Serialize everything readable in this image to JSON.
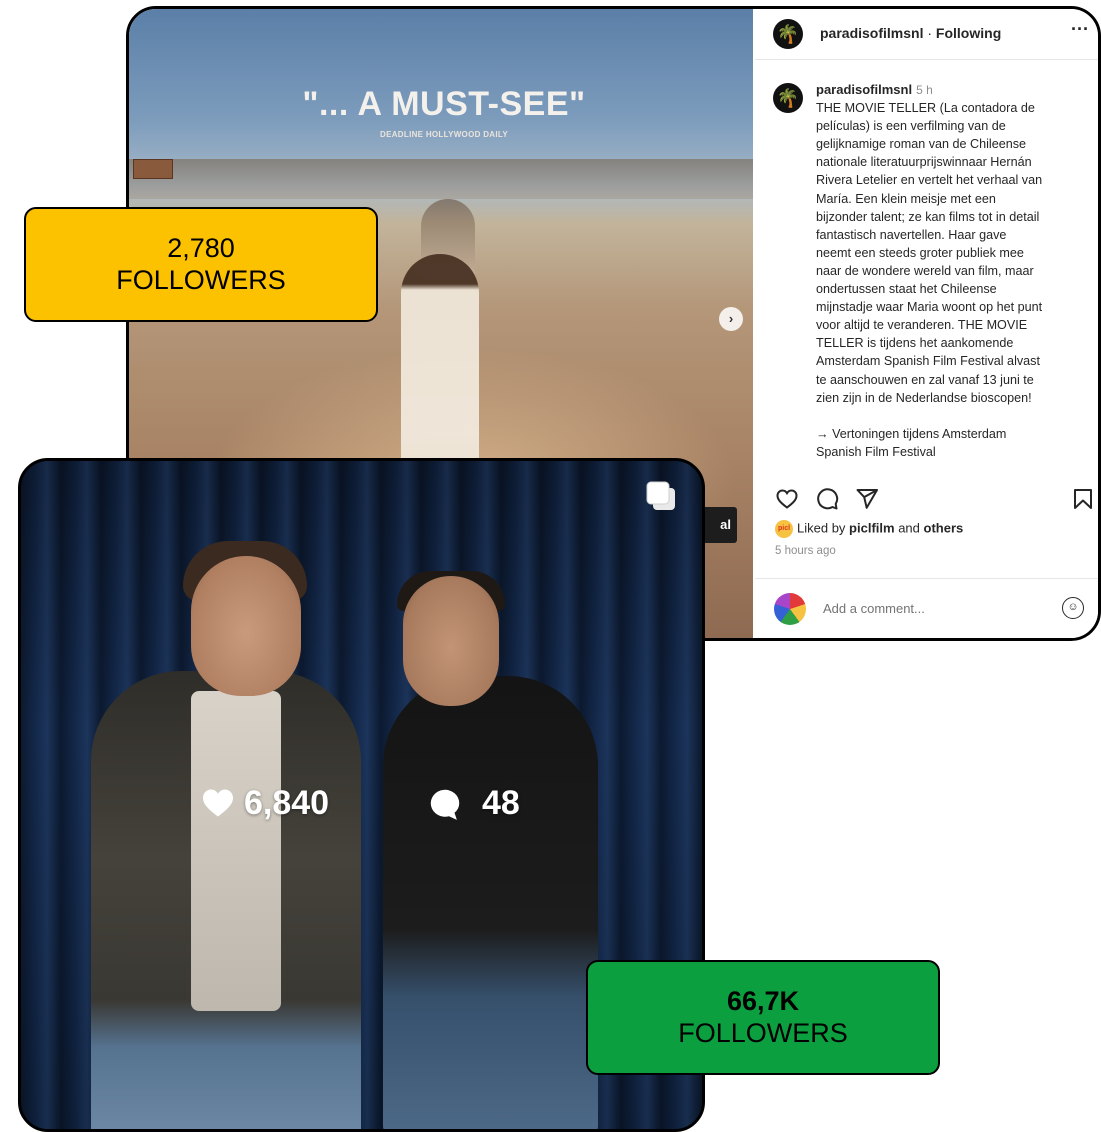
{
  "post": {
    "image": {
      "headline": "\"... A MUST-SEE\"",
      "subhead": "DEADLINE HOLLYWOOD DAILY",
      "label_tag": "al"
    },
    "header": {
      "account": "paradisofilmsnl",
      "separator": "·",
      "following": "Following",
      "more": "···"
    },
    "caption": {
      "user": "paradisofilmsnl",
      "time": "5 h",
      "lines": [
        "THE MOVIE TELLER (La contadora de",
        "películas) is een verfilming van de",
        "gelijknamige roman van de Chileense",
        "nationale literatuurprijswinnaar Hernán",
        "Rivera Letelier en vertelt het verhaal van",
        "María. Een klein meisje met een",
        "bijzonder talent; ze kan films tot in detail",
        "fantastisch navertellen. Haar gave",
        "neemt een steeds groter publiek mee",
        "naar de wondere wereld van film, maar",
        "ondertussen staat het Chileense",
        "mijnstadje waar Maria woont op het punt",
        "voor altijd te veranderen. THE MOVIE",
        "TELLER is tijdens het aankomende",
        "Amsterdam Spanish Film Festival alvast",
        "te aanschouwen en zal vanaf 13 juni te",
        "zien zijn in de Nederlandse bioscopen!"
      ],
      "after_gap": [
        "→ Vertoningen tijdens Amsterdam",
        "Spanish Film Festival"
      ]
    },
    "likes": {
      "badge": "picl",
      "prefix": "Liked by",
      "user": "piclfilm",
      "and": "and",
      "others": "others"
    },
    "timestamp": "5 hours ago",
    "comment_placeholder": "Add a comment..."
  },
  "photo": {
    "likes": "6,840",
    "comments": "48"
  },
  "badges": {
    "yellow": {
      "count": "2,780",
      "word": "FOLLOWERS"
    },
    "green": {
      "count": "66,7K",
      "word": "FOLLOWERS"
    }
  },
  "colors": {
    "yellow_badge": "#fcc200",
    "green_badge": "#0b9f3f"
  },
  "icons": [
    "palm-logo-icon",
    "heart-icon",
    "comment-icon",
    "share-icon",
    "bookmark-icon",
    "emoji-icon",
    "next-arrow-icon",
    "multiple-images-icon"
  ]
}
